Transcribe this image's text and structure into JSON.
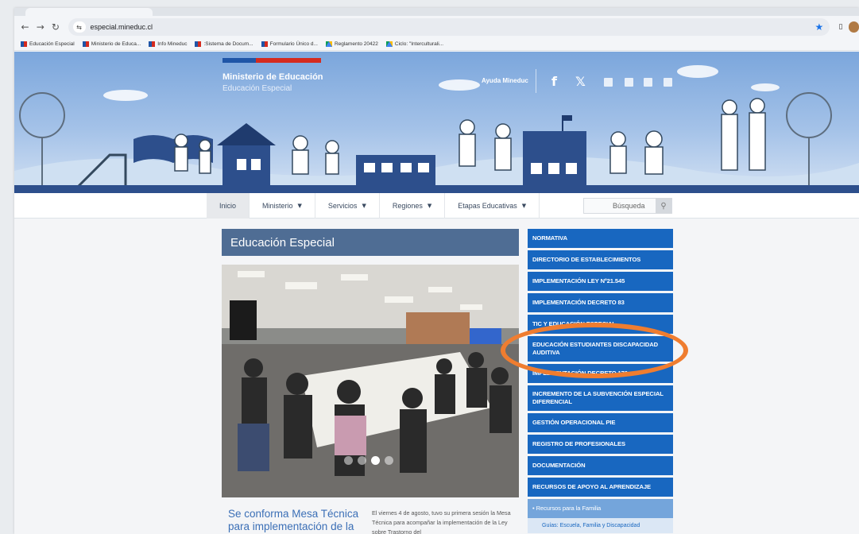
{
  "browser": {
    "url": "especial.mineduc.cl",
    "bookmarks": [
      {
        "label": "Educación Especial",
        "icon": "flag-favicon"
      },
      {
        "label": "Ministerio de Educa...",
        "icon": "flag-favicon"
      },
      {
        "label": "Info Mineduc",
        "icon": "flag-favicon"
      },
      {
        "label": ":Sistema de Docum...",
        "icon": "flag-favicon"
      },
      {
        "label": "Formulario Único d...",
        "icon": "flag-favicon"
      },
      {
        "label": "Reglamento 20422",
        "icon": "drive-icon"
      },
      {
        "label": "Ciclo: \"Interculturali...",
        "icon": "drive-icon"
      }
    ]
  },
  "header": {
    "ministry": "Ministerio de Educación",
    "site": "Educación Especial",
    "help": "Ayuda Mineduc",
    "social": {
      "facebook": "f",
      "twitter": "𝕏"
    }
  },
  "menu": {
    "items": [
      {
        "label": "Inicio",
        "caret": ""
      },
      {
        "label": "Ministerio",
        "caret": "▼"
      },
      {
        "label": "Servicios",
        "caret": "▼"
      },
      {
        "label": "Regiones",
        "caret": "▼"
      },
      {
        "label": "Etapas Educativas",
        "caret": "▼"
      }
    ],
    "search_placeholder": "Búsqueda"
  },
  "main": {
    "section_title": "Educación Especial",
    "news_headline": "Se conforma Mesa Técnica para implementación de la Ley TEA",
    "news_excerpt": "El viernes 4 de agosto, tuvo su primera sesión la Mesa Técnica para acompañar la implementación de la Ley sobre Trastorno del",
    "carousel_slides": 4,
    "carousel_active": 3
  },
  "sidebar": {
    "items": [
      "NORMATIVA",
      "DIRECTORIO DE ESTABLECIMIENTOS",
      "IMPLEMENTACIÓN LEY Nº21.545",
      "IMPLEMENTACIÓN DECRETO 83",
      "TIC Y EDUCACIÓN ESPECIAL",
      "EDUCACIÓN ESTUDIANTES DISCAPACIDAD AUDITIVA",
      "IMPLEMENTACIÓN DECRETO 170",
      "INCREMENTO DE LA SUBVENCIÓN ESPECIAL DIFERENCIAL",
      "GESTIÓN OPERACIONAL PIE",
      "REGISTRO DE PROFESIONALES",
      "DOCUMENTACIÓN",
      "RECURSOS DE APOYO AL APRENDIZAJE"
    ],
    "sub_item": "• Recursos para la Familia",
    "sub_sub_item": "Guías: Escuela, Familia y Discapacidad"
  },
  "colors": {
    "sidebar_blue": "#1867c0",
    "title_bar": "#4f6d94",
    "highlight": "#ef7d30",
    "link": "#3b6fb6"
  }
}
